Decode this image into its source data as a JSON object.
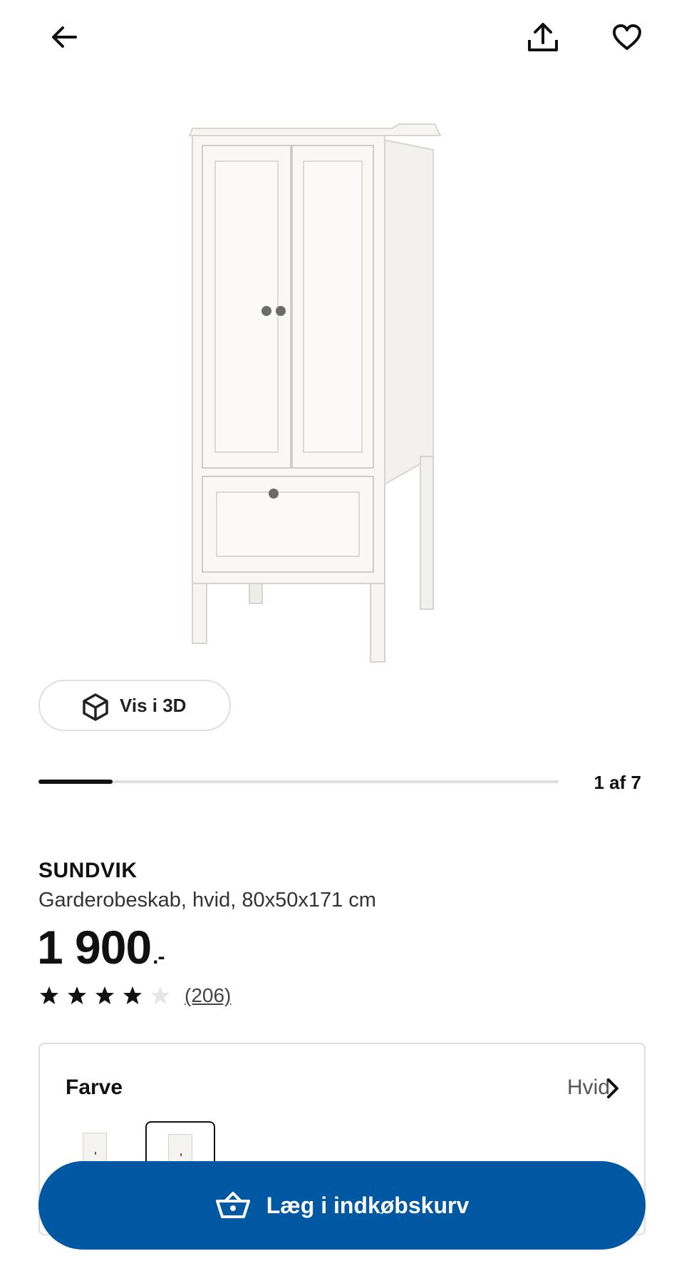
{
  "header": {
    "back_icon": "arrow-left-icon",
    "share_icon": "share-icon",
    "favorite_icon": "heart-icon"
  },
  "gallery": {
    "view_3d_label": "Vis i 3D",
    "view_3d_icon": "cube-icon",
    "page_counter": "1 af 7",
    "current_image": 1,
    "total_images": 7
  },
  "product": {
    "name": "SUNDVIK",
    "description": "Garderobeskab, hvid, 80x50x171 cm",
    "price": "1 900",
    "price_suffix": ".-",
    "rating": 4,
    "rating_max": 5,
    "review_count": "(206)"
  },
  "color_selector": {
    "title": "Farve",
    "selected_value": "Hvid",
    "chevron_icon": "chevron-right-icon",
    "swatches": [
      {
        "label": "white wardrobe variant",
        "selected": false
      },
      {
        "label": "white wardrobe variant",
        "selected": true
      }
    ]
  },
  "cta": {
    "label": "Læg i indkøbskurv",
    "icon": "basket-icon",
    "color": "#0058a3"
  }
}
